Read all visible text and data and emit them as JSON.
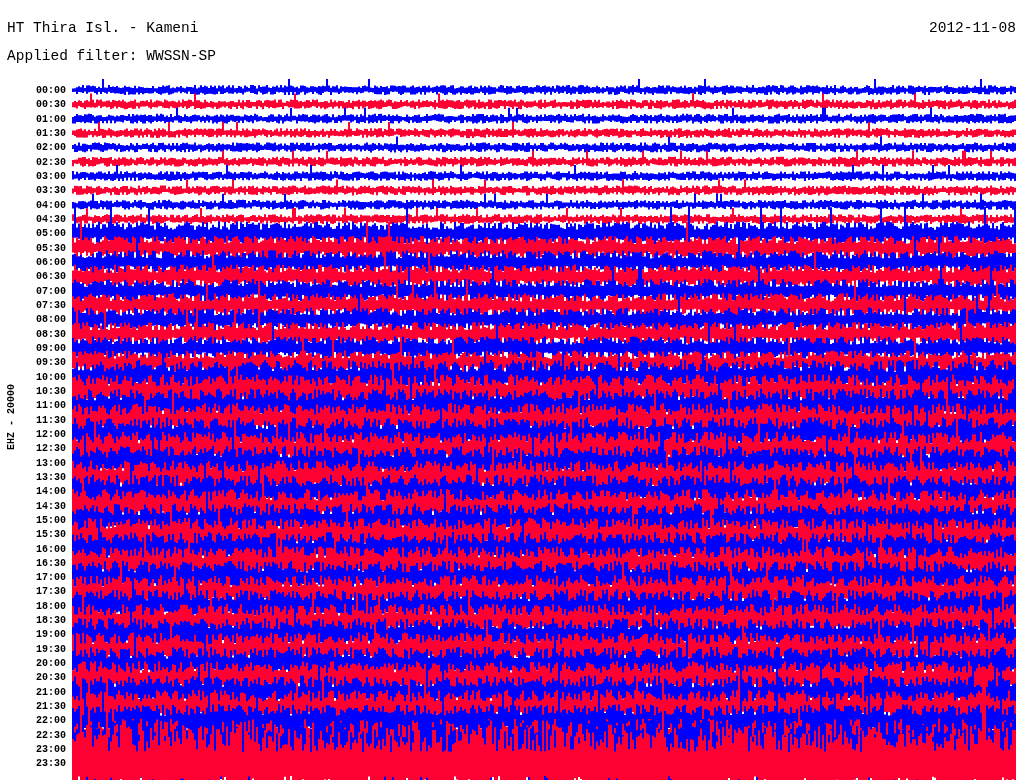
{
  "header": {
    "station": "HT Thira Isl. - Kameni",
    "date": "2012-11-08",
    "filter": "Applied filter: WWSSN-SP"
  },
  "axis_label": "EHZ - 20000",
  "rows": [
    {
      "time": "00:00"
    },
    {
      "time": "00:30"
    },
    {
      "time": "01:00"
    },
    {
      "time": "01:30"
    },
    {
      "time": "02:00"
    },
    {
      "time": "02:30"
    },
    {
      "time": "03:00"
    },
    {
      "time": "03:30"
    },
    {
      "time": "04:00"
    },
    {
      "time": "04:30"
    },
    {
      "time": "05:00"
    },
    {
      "time": "05:30"
    },
    {
      "time": "06:00"
    },
    {
      "time": "06:30"
    },
    {
      "time": "07:00"
    },
    {
      "time": "07:30"
    },
    {
      "time": "08:00"
    },
    {
      "time": "08:30"
    },
    {
      "time": "09:00"
    },
    {
      "time": "09:30"
    },
    {
      "time": "10:00"
    },
    {
      "time": "10:30"
    },
    {
      "time": "11:00"
    },
    {
      "time": "11:30"
    },
    {
      "time": "12:00"
    },
    {
      "time": "12:30"
    },
    {
      "time": "13:00"
    },
    {
      "time": "13:30"
    },
    {
      "time": "14:00"
    },
    {
      "time": "14:30"
    },
    {
      "time": "15:00"
    },
    {
      "time": "15:30"
    },
    {
      "time": "16:00"
    },
    {
      "time": "16:30"
    },
    {
      "time": "17:00"
    },
    {
      "time": "17:30"
    },
    {
      "time": "18:00"
    },
    {
      "time": "18:30"
    },
    {
      "time": "19:00"
    },
    {
      "time": "19:30"
    },
    {
      "time": "20:00"
    },
    {
      "time": "20:30"
    },
    {
      "time": "21:00"
    },
    {
      "time": "21:30"
    },
    {
      "time": "22:00"
    },
    {
      "time": "22:30"
    },
    {
      "time": "23:00"
    },
    {
      "time": "23:30"
    }
  ]
}
